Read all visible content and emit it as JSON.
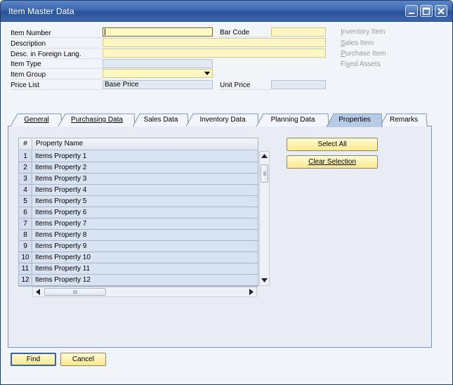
{
  "window": {
    "title": "Item Master Data"
  },
  "header": {
    "item_number": {
      "label": "Item Number",
      "value": ""
    },
    "bar_code": {
      "label": "Bar Code",
      "value": ""
    },
    "description": {
      "label": "Description",
      "value": ""
    },
    "desc_foreign": {
      "label": "Desc. in Foreign Lang.",
      "value": ""
    },
    "item_type": {
      "label": "Item Type",
      "value": ""
    },
    "item_group": {
      "label": "Item Group",
      "value": ""
    },
    "price_list": {
      "label": "Price List",
      "value": "Base Price"
    },
    "unit_price": {
      "label": "Unit Price",
      "value": ""
    }
  },
  "checkbox_labels": [
    {
      "underline": "I",
      "rest": "nventory Item"
    },
    {
      "underline": "S",
      "rest": "ales Item"
    },
    {
      "underline": "P",
      "rest": "urchase Item"
    },
    {
      "pre": "Fi",
      "underline": "x",
      "rest": "ed Assets"
    }
  ],
  "tabs": [
    {
      "label": "General",
      "active": false
    },
    {
      "label": "Purchasing Data",
      "active": false
    },
    {
      "label": "Sales Data",
      "active": false
    },
    {
      "label": "Inventory Data",
      "active": false
    },
    {
      "label": "Planning Data",
      "active": false
    },
    {
      "label": "Properties",
      "active": true
    },
    {
      "label": "Remarks",
      "active": false
    }
  ],
  "grid": {
    "columns": [
      "#",
      "Property Name"
    ],
    "rows": [
      {
        "num": "1",
        "name": "Items Property 1"
      },
      {
        "num": "2",
        "name": "Items Property 2"
      },
      {
        "num": "3",
        "name": "Items Property 3"
      },
      {
        "num": "4",
        "name": "Items Property 4"
      },
      {
        "num": "5",
        "name": "Items Property 5"
      },
      {
        "num": "6",
        "name": "Items Property 6"
      },
      {
        "num": "7",
        "name": "Items Property 7"
      },
      {
        "num": "8",
        "name": "Items Property 8"
      },
      {
        "num": "9",
        "name": "Items Property 9"
      },
      {
        "num": "10",
        "name": "Items Property 10"
      },
      {
        "num": "11",
        "name": "Items Property 11"
      },
      {
        "num": "12",
        "name": "Items Property 12"
      }
    ]
  },
  "buttons": {
    "select_all": "Select All",
    "clear_selection": "Clear Selection",
    "find": "Find",
    "cancel": "Cancel"
  },
  "colors": {
    "titlebar": "#3b66ad",
    "required_field": "#fdf7c1",
    "readonly_field": "#e3e9f3",
    "button": "#fbe98d",
    "disabled_text": "#9b9b9b"
  }
}
